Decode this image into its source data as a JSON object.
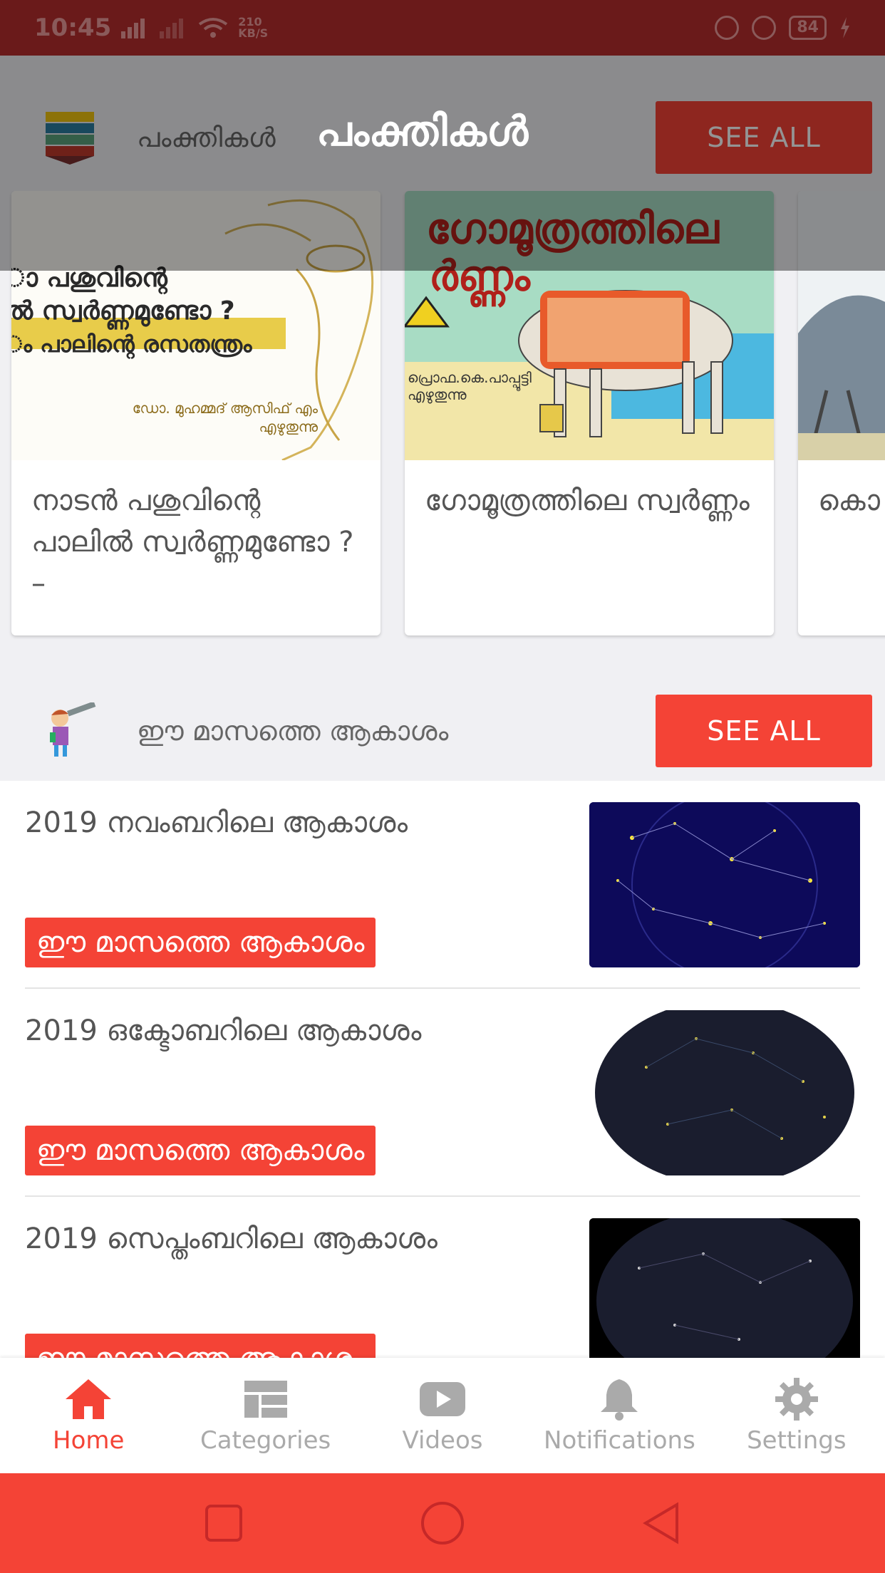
{
  "status_bar": {
    "time": "10:45",
    "net_speed_value": "210",
    "net_speed_unit": "KB/S",
    "battery": "84"
  },
  "header": {
    "big_title": "പംക്തികൾ"
  },
  "section1": {
    "title": "പംക്തികൾ",
    "see_all": "SEE ALL"
  },
  "cards": [
    {
      "title": "നാടൻ പശുവിന്റെ പാലിൽ സ്വർണ്ണമുണ്ടോ ? –",
      "image_lines": [
        "ാ പശുവിന്റെ",
        "ൽ സ്വർണ്ണമുണ്ടോ ?",
        "ം പാലിന്റെ രസതന്ത്രം",
        "ഡോ. മുഹമ്മദ് ആസിഫ് എം",
        "എഴുതുന്നു"
      ]
    },
    {
      "title": "ഗോമൂത്രത്തിലെ സ്വർണ്ണം",
      "image_lines": [
        "ഗോമൂത്രത്തിലെ",
        "ർണ്ണം",
        "പ്രൊഫ.കെ.പാപ്പൂട്ടി",
        "എഴുതുന്നു"
      ]
    },
    {
      "title": "കൊ കണ"
    }
  ],
  "section2": {
    "title": "ഈ മാസത്തെ ആകാശം",
    "see_all": "SEE ALL"
  },
  "sky_list": [
    {
      "title": "2019 നവംബറിലെ ആകാശം",
      "tag": "ഈ മാസത്തെ ആകാശം"
    },
    {
      "title": "2019 ഒക്ടോബറിലെ ആകാശം",
      "tag": "ഈ മാസത്തെ ആകാശം"
    },
    {
      "title": "2019 സെപ്തംബറിലെ ആകാശം",
      "tag": "ഈ മാസത്തെ ആകാശം"
    }
  ],
  "bottom_nav": [
    {
      "label": "Home",
      "icon": "home-icon",
      "active": true
    },
    {
      "label": "Categories",
      "icon": "categories-icon"
    },
    {
      "label": "Videos",
      "icon": "videos-icon"
    },
    {
      "label": "Notifications",
      "icon": "bell-icon"
    },
    {
      "label": "Settings",
      "icon": "gear-icon"
    }
  ],
  "colors": {
    "accent": "#f44336",
    "status_bar": "#6a1a1a"
  }
}
